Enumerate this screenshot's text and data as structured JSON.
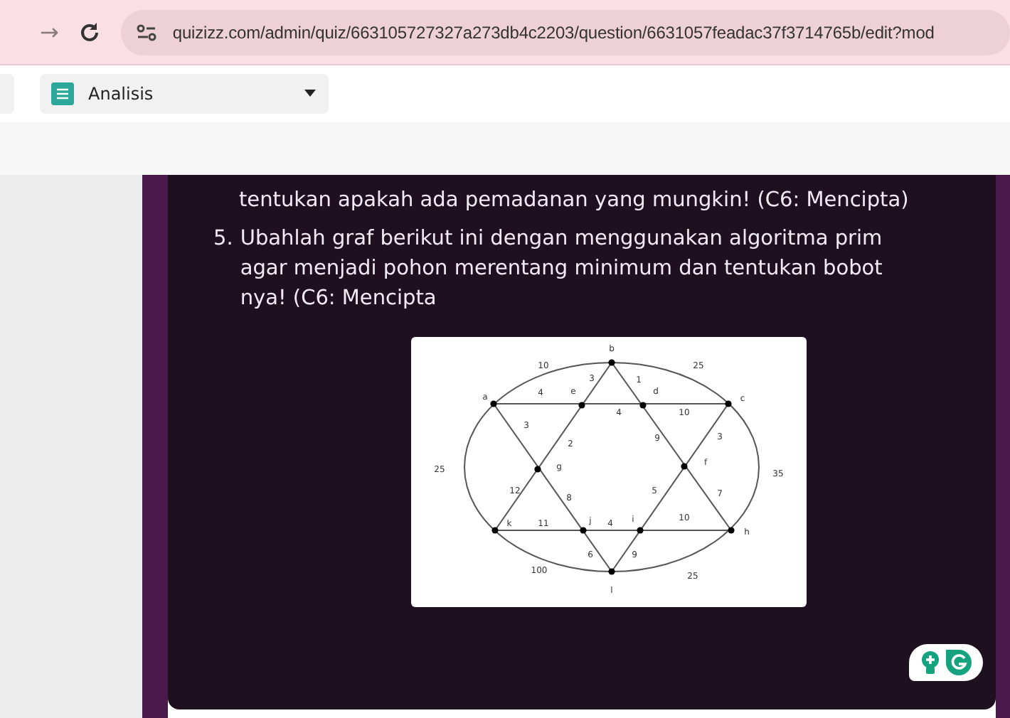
{
  "browser": {
    "forward": "→",
    "url": "quizizz.com/admin/quiz/663105727327a273db4c2203/question/6631057feadac37f3714765b/edit?mod"
  },
  "toolbar": {
    "dropdown": {
      "value": "Analisis"
    }
  },
  "question": {
    "previous_line": "tentukan apakah ada pemadanan yang mungkin! (C6: Mencipta)",
    "items": [
      {
        "number": "5.",
        "text": "Ubahlah graf berikut ini dengan menggunakan algoritma prim agar menjadi pohon merentang minimum dan tentukan bobot nya! (C6: Mencipta"
      }
    ]
  },
  "graph": {
    "node_labels": [
      "b",
      "a",
      "e",
      "d",
      "c",
      "g",
      "f",
      "k",
      "j",
      "i",
      "h",
      "l"
    ],
    "edge_weights": [
      "10",
      "25",
      "3",
      "1",
      "4",
      "4",
      "10",
      "3",
      "2",
      "9",
      "3",
      "25",
      "35",
      "12",
      "8",
      "5",
      "7",
      "11",
      "4",
      "10",
      "6",
      "9",
      "100",
      "25"
    ]
  }
}
